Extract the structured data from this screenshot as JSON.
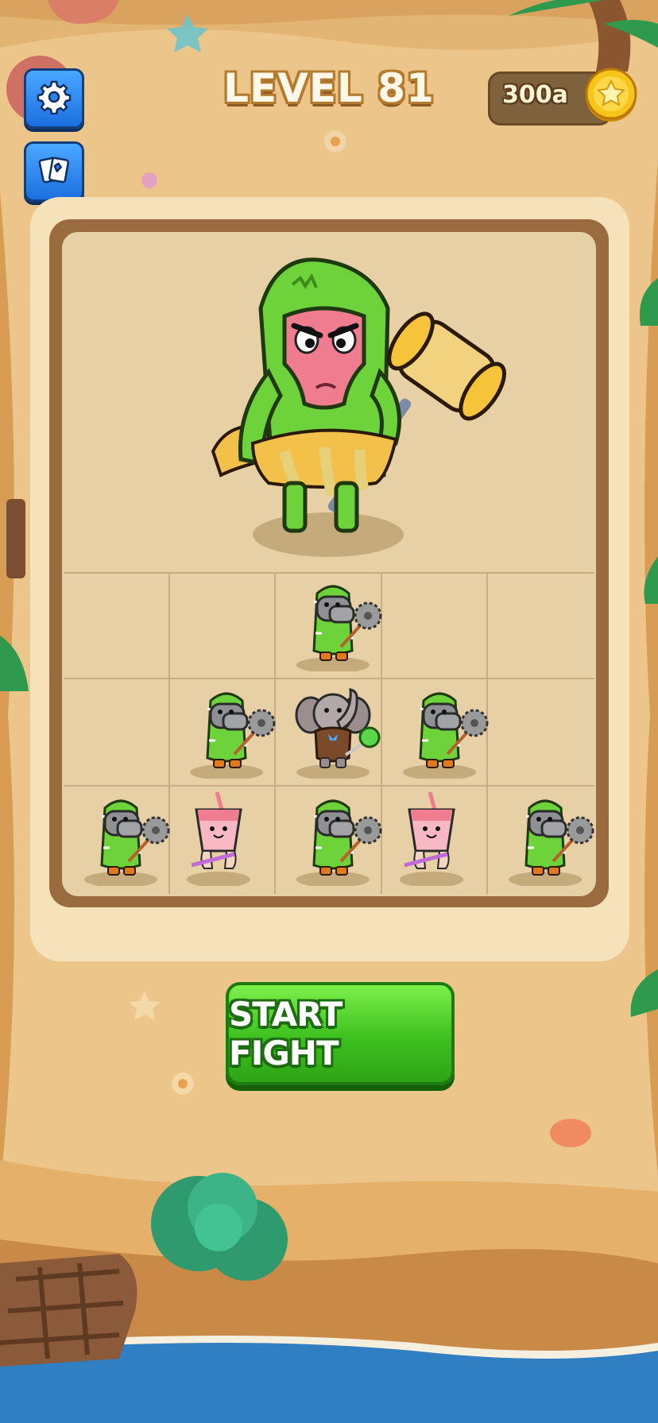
{
  "header": {
    "level_title": "LEVEL 81",
    "coins": "300a"
  },
  "buttons": {
    "settings_icon": "gear-icon",
    "cards_icon": "cards-icon",
    "start_fight": "START FIGHT"
  },
  "board": {
    "boss": "cactus-boss-with-hammer",
    "grid_rows": 3,
    "grid_cols": 5,
    "units": [
      {
        "row": 0,
        "col": 2,
        "type": "cactus-hippo-saw"
      },
      {
        "row": 1,
        "col": 1,
        "type": "cactus-hippo-saw"
      },
      {
        "row": 1,
        "col": 2,
        "type": "elephant-lollipop"
      },
      {
        "row": 1,
        "col": 3,
        "type": "cactus-hippo-saw"
      },
      {
        "row": 2,
        "col": 0,
        "type": "cactus-hippo-saw"
      },
      {
        "row": 2,
        "col": 1,
        "type": "smoothie-cup"
      },
      {
        "row": 2,
        "col": 2,
        "type": "cactus-hippo-saw"
      },
      {
        "row": 2,
        "col": 3,
        "type": "smoothie-cup"
      },
      {
        "row": 2,
        "col": 4,
        "type": "cactus-hippo-saw"
      }
    ]
  },
  "colors": {
    "sand": "#ecc58a",
    "board_frame": "#9a6b3e",
    "start_button": "#3dbf1e",
    "icon_button": "#1c6fe0",
    "coin": "#f5c518"
  }
}
